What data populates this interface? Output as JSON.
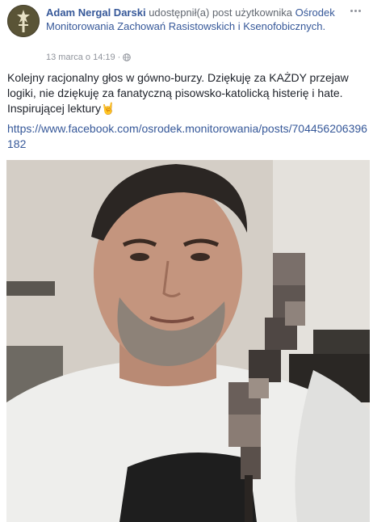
{
  "post": {
    "author": "Adam Nergal Darski",
    "action": "udostępnił(a) post użytkownika",
    "shared_page": "Ośrodek Monitorowania Zachowań Rasistowskich i Ksenofobicznych.",
    "timestamp": "13 marca o 14:19",
    "separator": "·",
    "privacy_icon": "globe-icon",
    "body_text": "Kolejny racjonalny głos w gówno-burzy. Dziękuję za KAŻDY przejaw logiki, nie dziękuję za fanatyczną pisowsko-katolicką histerię i hate. Inspirującej lektury🤘",
    "link": "https://www.facebook.com/osrodek.monitorowania/posts/704456206396182",
    "more_icon": "more-options-icon"
  },
  "colors": {
    "link": "#365899",
    "text": "#1d2129",
    "meta": "#90949c"
  }
}
